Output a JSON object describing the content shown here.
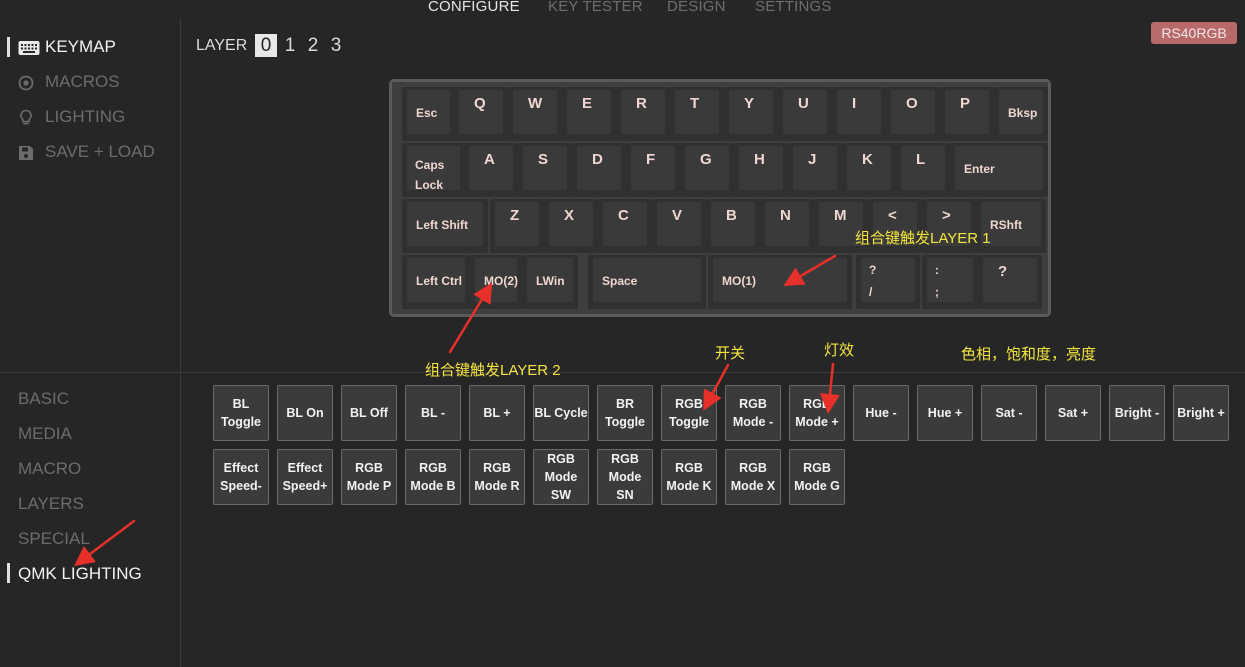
{
  "top_nav": {
    "tabs": [
      "CONFIGURE",
      "KEY TESTER",
      "DESIGN",
      "SETTINGS"
    ],
    "active_tab": "CONFIGURE"
  },
  "device_badge": "RS40RGB",
  "sidebar": {
    "items": [
      {
        "label": "KEYMAP",
        "icon": "keyboard-icon",
        "active": true
      },
      {
        "label": "MACROS",
        "icon": "target-icon",
        "active": false
      },
      {
        "label": "LIGHTING",
        "icon": "lightbulb-icon",
        "active": false
      },
      {
        "label": "SAVE + LOAD",
        "icon": "floppy-icon",
        "active": false
      }
    ]
  },
  "layer_selector": {
    "label": "LAYER",
    "layers": [
      "0",
      "1",
      "2",
      "3"
    ],
    "active_layer": "0"
  },
  "keyboard": {
    "rows": [
      [
        "Esc",
        "Q",
        "W",
        "E",
        "R",
        "T",
        "Y",
        "U",
        "I",
        "O",
        "P",
        "Bksp"
      ],
      [
        "Caps\nLock",
        "A",
        "S",
        "D",
        "F",
        "G",
        "H",
        "J",
        "K",
        "L",
        "Enter"
      ],
      [
        "Left Shift",
        "Z",
        "X",
        "C",
        "V",
        "B",
        "N",
        "M",
        "<",
        ">",
        "RShft"
      ],
      [
        "Left Ctrl",
        "MO(2)",
        "LWin",
        "Space",
        "MO(1)",
        "?\n/",
        ":\n;",
        "?"
      ]
    ]
  },
  "categories": {
    "items": [
      "BASIC",
      "MEDIA",
      "MACRO",
      "LAYERS",
      "SPECIAL",
      "QMK LIGHTING"
    ],
    "active": "QMK LIGHTING"
  },
  "lighting_keys": {
    "row1": [
      "BL\nToggle",
      "BL On",
      "BL Off",
      "BL -",
      "BL +",
      "BL Cycle",
      "BR\nToggle",
      "RGB\nToggle",
      "RGB\nMode -",
      "RGB\nMode +",
      "Hue -",
      "Hue +",
      "Sat -",
      "Sat +",
      "Bright -",
      "Bright +"
    ],
    "row2": [
      "Effect\nSpeed-",
      "Effect\nSpeed+",
      "RGB\nMode P",
      "RGB\nMode B",
      "RGB\nMode R",
      "RGB\nMode\nSW",
      "RGB\nMode\nSN",
      "RGB\nMode K",
      "RGB\nMode X",
      "RGB\nMode G"
    ]
  },
  "annotations": {
    "layer1": "组合键触发LAYER 1",
    "layer2": "组合键触发LAYER 2",
    "toggle": "开关",
    "effect": "灯效",
    "hsv": "色相，饱和度，亮度"
  },
  "colors": {
    "background": "#262626",
    "badge": "#b86a6a",
    "key_label": "#f0d6d0",
    "annotation": "#f5e63c",
    "arrow": "#e8302a"
  }
}
